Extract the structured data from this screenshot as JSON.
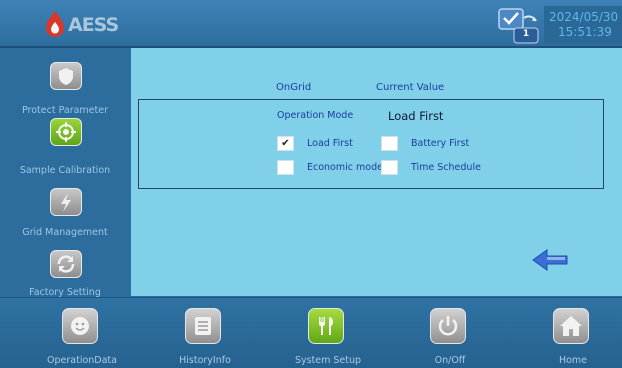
{
  "header": {
    "logo_text": "AESS",
    "date": "2024/05/30",
    "time": "15:51:39",
    "screen_badge": "1"
  },
  "sidebar": {
    "items": [
      {
        "label": "Protect Parameter",
        "icon": "shield-icon"
      },
      {
        "label": "Sample Calibration",
        "icon": "target-icon"
      },
      {
        "label": "Grid Management",
        "icon": "lightning-icon"
      },
      {
        "label": "Factory Setting",
        "icon": "refresh-icon"
      }
    ]
  },
  "main": {
    "col_ongrid": "OnGrid",
    "col_current": "Current Value",
    "operation_mode_label": "Operation Mode",
    "operation_mode_value": "Load First",
    "options": [
      {
        "label": "Load First",
        "checked": true
      },
      {
        "label": "Battery First",
        "checked": false
      },
      {
        "label": "Economic mode",
        "checked": false
      },
      {
        "label": "Time Schedule",
        "checked": false
      }
    ]
  },
  "footer": {
    "items": [
      {
        "label": "OperationData",
        "icon": "smiley-icon"
      },
      {
        "label": "HistoryInfo",
        "icon": "list-icon"
      },
      {
        "label": "System Setup",
        "icon": "tools-icon"
      },
      {
        "label": "On/Off",
        "icon": "power-icon"
      },
      {
        "label": "Home",
        "icon": "home-icon"
      }
    ]
  },
  "colors": {
    "accent": "#7fd0e8",
    "sidebar": "#2c6d9d",
    "system_setup_active": "#7dc418"
  }
}
